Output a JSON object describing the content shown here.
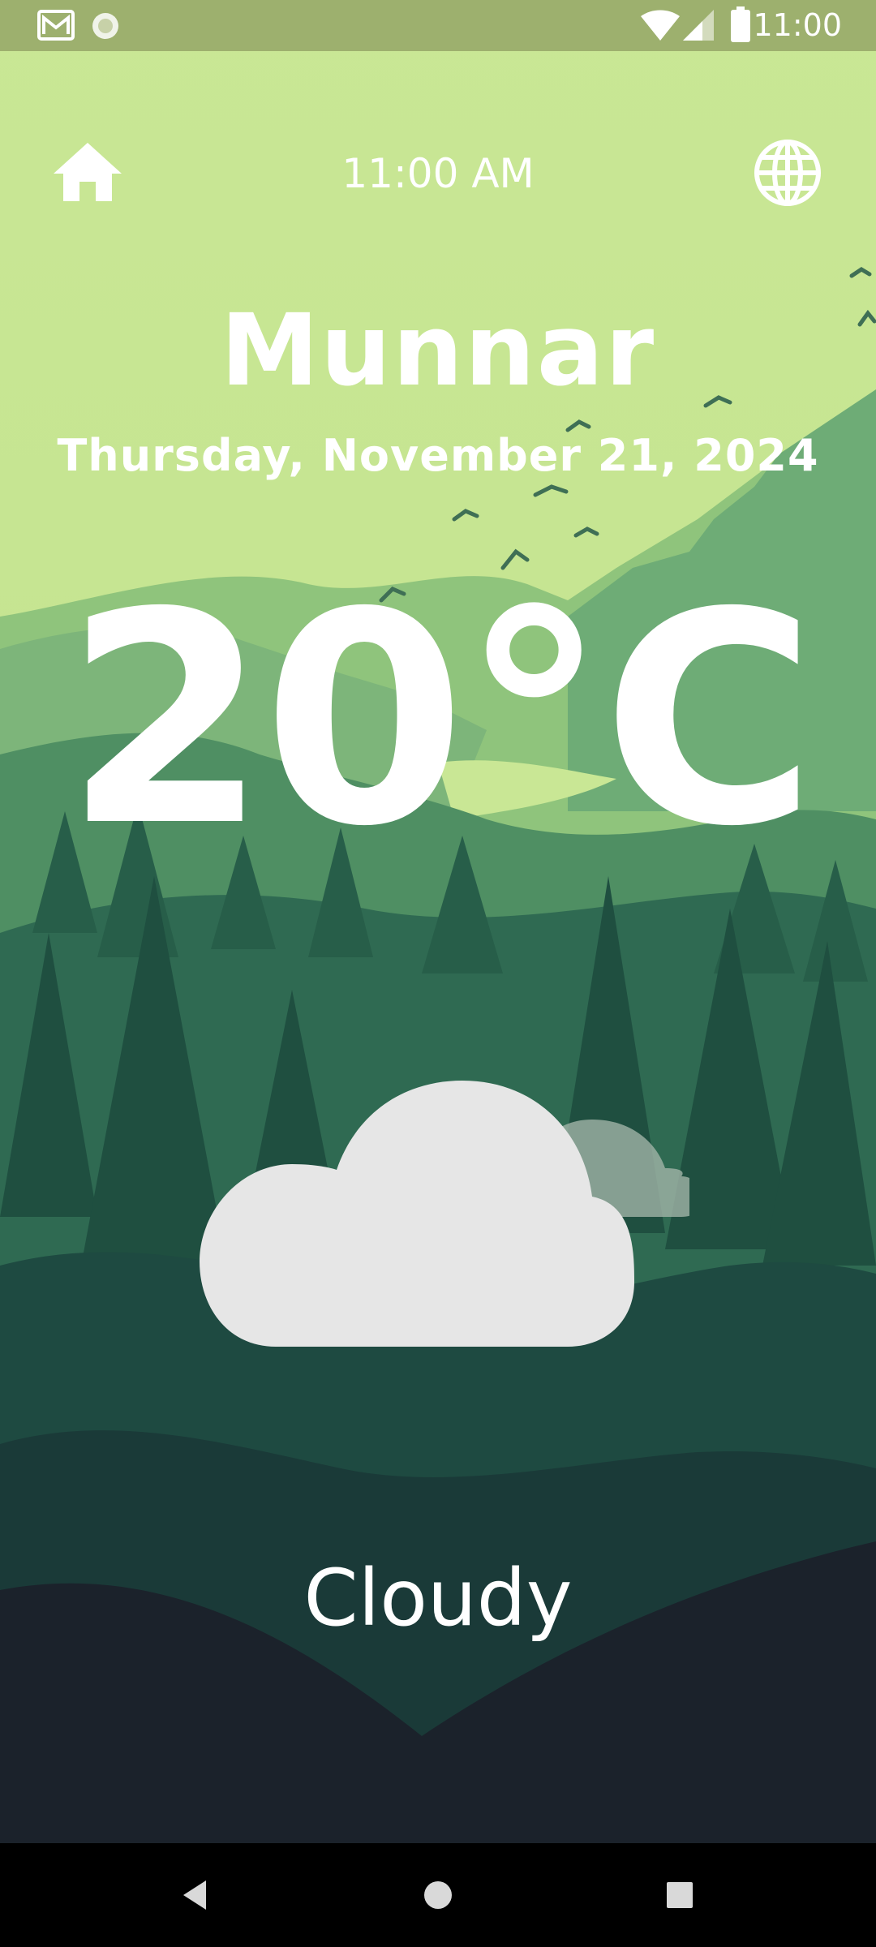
{
  "status_bar": {
    "time": "11:00",
    "icons": [
      "gmail-icon",
      "sync-icon",
      "wifi-icon",
      "signal-icon",
      "battery-icon"
    ]
  },
  "header": {
    "home_icon": "home-icon",
    "time": "11:00 AM",
    "language_icon": "globe-icon"
  },
  "weather": {
    "city": "Munnar",
    "date": "Thursday, November 21, 2024",
    "temperature": "20°C",
    "condition": "Cloudy",
    "condition_icon": "cloud-icon"
  },
  "nav_bar": {
    "buttons": [
      "back-icon",
      "home-circle-icon",
      "recents-icon"
    ]
  },
  "colors": {
    "sky": "#c9e795",
    "status_bar": "#9db06e",
    "text": "#ffffff",
    "cloud": "#e6e6e6",
    "ground": "#1b222b"
  }
}
